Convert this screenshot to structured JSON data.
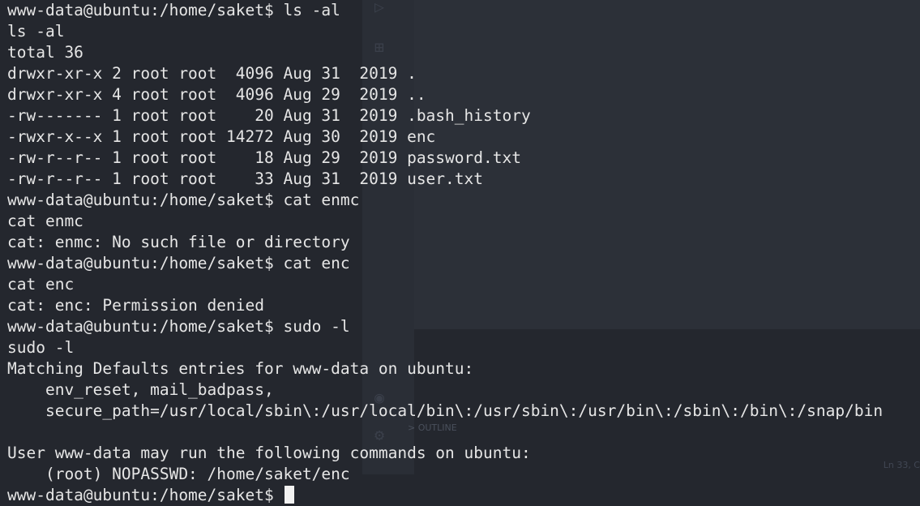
{
  "terminal": {
    "lines": [
      "www-data@ubuntu:/home/saket$ ls -al",
      "ls -al",
      "total 36",
      "drwxr-xr-x 2 root root  4096 Aug 31  2019 .",
      "drwxr-xr-x 4 root root  4096 Aug 29  2019 ..",
      "-rw------- 1 root root    20 Aug 31  2019 .bash_history",
      "-rwxr-x--x 1 root root 14272 Aug 30  2019 enc",
      "-rw-r--r-- 1 root root    18 Aug 29  2019 password.txt",
      "-rw-r--r-- 1 root root    33 Aug 31  2019 user.txt",
      "www-data@ubuntu:/home/saket$ cat enmc",
      "cat enmc",
      "cat: enmc: No such file or directory",
      "www-data@ubuntu:/home/saket$ cat enc",
      "cat enc",
      "cat: enc: Permission denied",
      "www-data@ubuntu:/home/saket$ sudo -l",
      "sudo -l",
      "Matching Defaults entries for www-data on ubuntu:",
      "    env_reset, mail_badpass,",
      "    secure_path=/usr/local/sbin\\:/usr/local/bin\\:/usr/sbin\\:/usr/bin\\:/sbin\\:/bin\\:/snap/bin",
      "",
      "User www-data may run the following commands on ubuntu:",
      "    (root) NOPASSWD: /home/saket/enc",
      "www-data@ubuntu:/home/saket$ "
    ]
  },
  "background": {
    "outline_label": "> OUTLINE",
    "status_position": "Ln 33, C"
  },
  "colors": {
    "background": "#24272e",
    "text": "#e6e6e6",
    "cursor": "#f2f2f2"
  }
}
